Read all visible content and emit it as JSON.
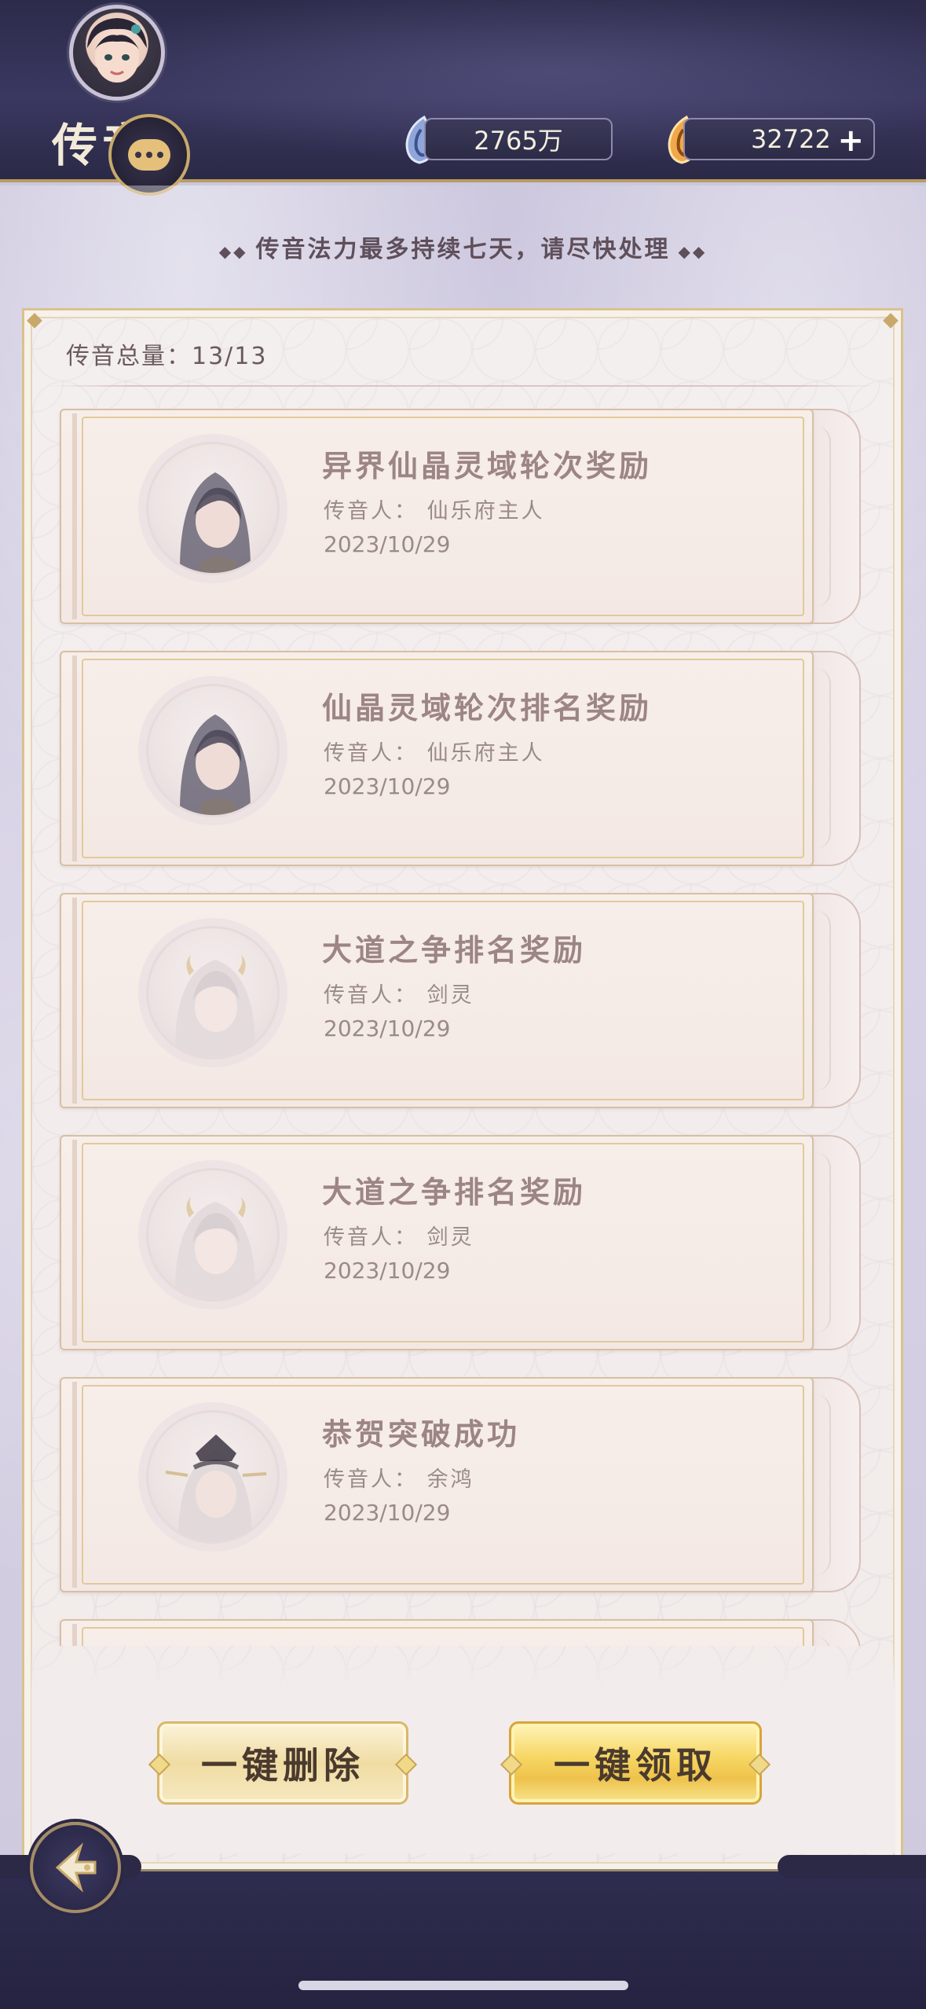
{
  "header": {
    "title": "传音",
    "currency_jade": "2765万",
    "currency_gold": "32722",
    "add_symbol": "+"
  },
  "notice": {
    "text": "传音法力最多持续七天，请尽快处理"
  },
  "summary": {
    "label": "传音总量：",
    "count": "13/13"
  },
  "mails": [
    {
      "title": "异界仙晶灵域轮次奖励",
      "sender": "传音人：  仙乐府主人",
      "date": "2023/10/29",
      "portrait": "dark-hair-man"
    },
    {
      "title": "仙晶灵域轮次排名奖励",
      "sender": "传音人：  仙乐府主人",
      "date": "2023/10/29",
      "portrait": "dark-hair-man"
    },
    {
      "title": "大道之争排名奖励",
      "sender": "传音人：  剑灵",
      "date": "2023/10/29",
      "portrait": "silver-hair-spirit"
    },
    {
      "title": "大道之争排名奖励",
      "sender": "传音人：  剑灵",
      "date": "2023/10/29",
      "portrait": "silver-hair-spirit"
    },
    {
      "title": "恭贺突破成功",
      "sender": "传音人：  余鸿",
      "date": "2023/10/29",
      "portrait": "crowned-elder"
    }
  ],
  "buttons": {
    "delete_all": "一键删除",
    "claim_all": "一键领取"
  },
  "icons": {
    "chat": "chat-bubble-icon",
    "jade": "jade-currency-icon",
    "gold": "gold-currency-icon",
    "back": "back-arrow-icon"
  },
  "colors": {
    "header_bg": "#2c2b4a",
    "gold_accent": "#c7a96a",
    "panel_bg": "#f4efef",
    "claim_button": "#f6d560"
  }
}
